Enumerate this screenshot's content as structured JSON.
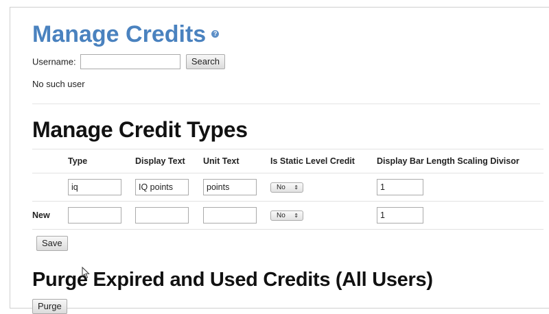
{
  "header": {
    "title": "Manage Credits",
    "help_glyph": "?",
    "help_icon": "help-icon"
  },
  "user_search": {
    "label": "Username:",
    "value": "",
    "search_label": "Search"
  },
  "status": "No such user",
  "credit_types": {
    "heading": "Manage Credit Types",
    "columns": [
      "",
      "Type",
      "Display Text",
      "Unit Text",
      "Is Static Level Credit",
      "Display Bar Length Scaling Divisor"
    ],
    "rows": [
      {
        "label": "",
        "type": "iq",
        "display_text": "IQ points",
        "unit_text": "points",
        "is_static": "No",
        "divisor": "1"
      },
      {
        "label": "New",
        "type": "",
        "display_text": "",
        "unit_text": "",
        "is_static": "No",
        "divisor": "1"
      }
    ],
    "select_arrows": "⇕",
    "save_label": "Save"
  },
  "purge": {
    "heading": "Purge Expired and Used Credits (All Users)",
    "button_label": "Purge"
  },
  "colors": {
    "title": "#4a82bf",
    "heading": "#111111"
  }
}
